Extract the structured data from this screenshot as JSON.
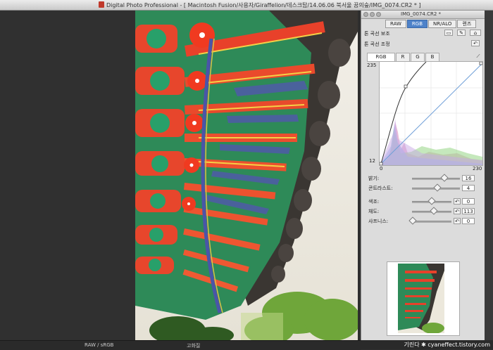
{
  "window": {
    "title": "Digital Photo Professional - [ Macintosh Fusion/사용자/Giraffelion/데스크탑/14.06.06 북서울 꿈의숲/IMG_0074.CR2 * ]"
  },
  "status": {
    "left": "RAW / sRGB",
    "center": "고화질"
  },
  "panel": {
    "title": "IMG_0074.CR2 *",
    "tabs": [
      {
        "label": "RAW",
        "active": false
      },
      {
        "label": "RGB",
        "active": true
      },
      {
        "label": "NR/ALO",
        "active": false
      },
      {
        "label": "렌즈",
        "active": false
      }
    ],
    "tone_curve_assist_label": "톤 곡선 보조",
    "tone_curve_adjust_label": "톤 곡선 조정",
    "channels": [
      "RGB",
      "R",
      "G",
      "B"
    ],
    "curve": {
      "top_value": "235",
      "bottom_value": "12",
      "x_min": "0",
      "x_max": "230"
    },
    "brightness": {
      "label": "밝기:",
      "value": "16",
      "fraction": 0.68
    },
    "contrast": {
      "label": "콘트라스트:",
      "value": "4",
      "fraction": 0.53
    },
    "hue": {
      "label": "색조:",
      "value": "0",
      "fraction": 0.5
    },
    "saturation": {
      "label": "채도:",
      "value": "113",
      "fraction": 0.56
    },
    "sharpness": {
      "label": "샤프니스:",
      "value": "0",
      "fraction": 0.02
    }
  },
  "watermark": "기린다 ✱ cyaneffect.tistory.com"
}
